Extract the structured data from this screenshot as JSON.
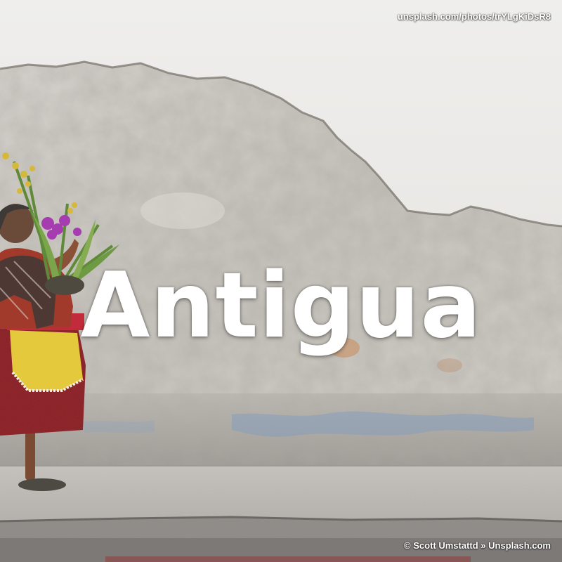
{
  "photo": {
    "source_url": "unsplash.com/photos/trYLgKiDsR8",
    "title": "Antigua",
    "credit": "© Scott Umstattd » Unsplash.com"
  },
  "colors": {
    "upper_wall": "#e9e7e5",
    "exposed_plaster": "#c9c5bf",
    "wall_base": "#b3b0aa",
    "sidewalk": "#c2bfba",
    "curb": "#8f8c88",
    "skirt": "#8b1d23",
    "apron": "#e4c93c",
    "flowers": "#a53cb0"
  }
}
